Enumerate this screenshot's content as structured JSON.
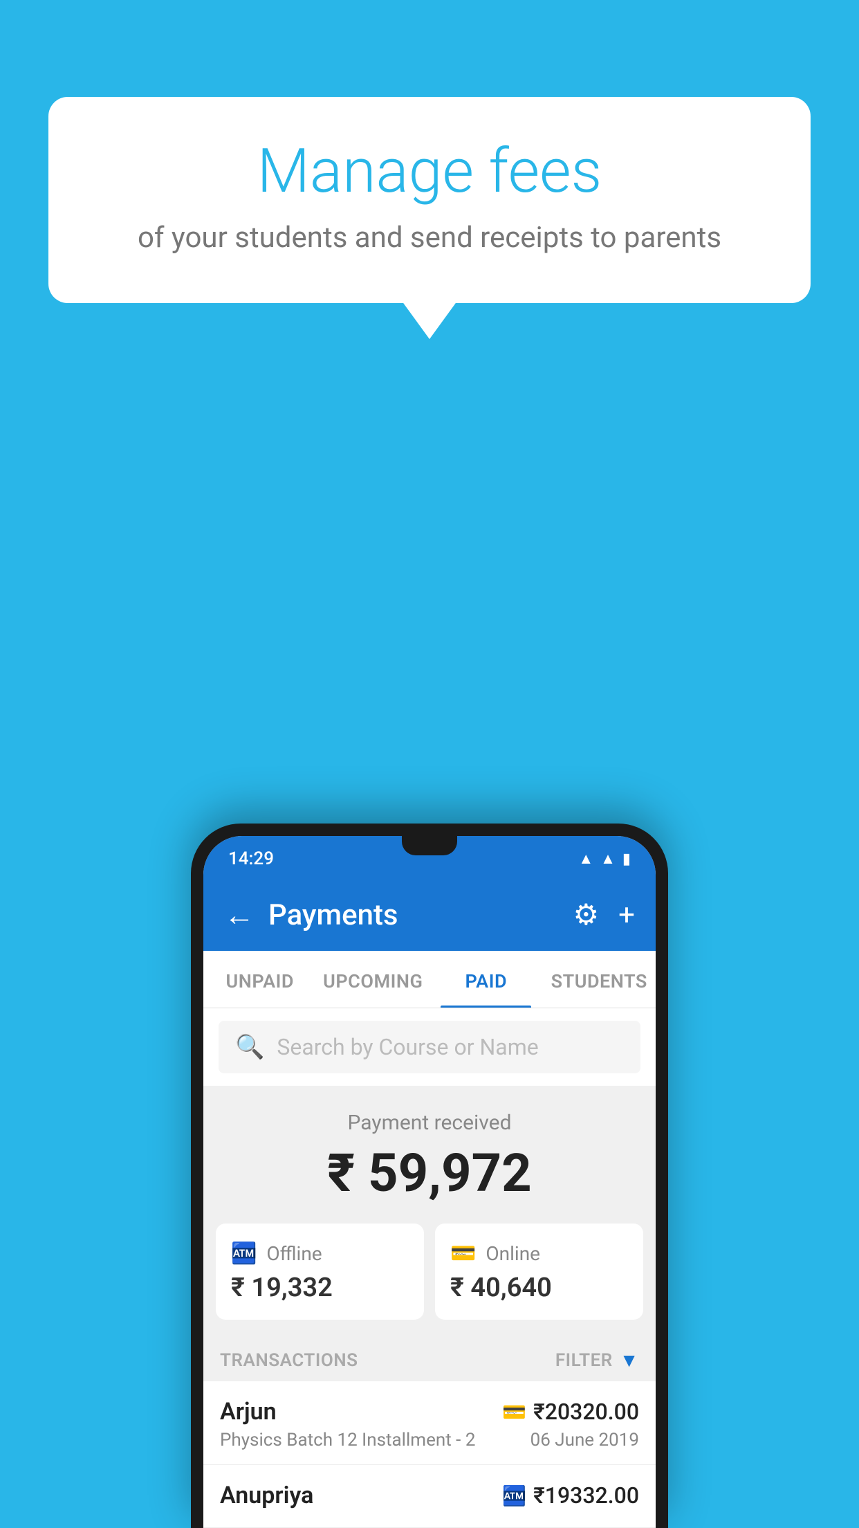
{
  "background_color": "#29B6E8",
  "speech_bubble": {
    "title": "Manage fees",
    "subtitle": "of your students and send receipts to parents"
  },
  "phone": {
    "status_bar": {
      "time": "14:29",
      "wifi": "▲",
      "signal": "▲",
      "battery": "▮"
    },
    "app_bar": {
      "title": "Payments",
      "back_label": "←",
      "settings_icon": "⚙",
      "add_icon": "+"
    },
    "tabs": [
      {
        "label": "UNPAID",
        "active": false
      },
      {
        "label": "UPCOMING",
        "active": false
      },
      {
        "label": "PAID",
        "active": true
      },
      {
        "label": "STUDENTS",
        "active": false
      }
    ],
    "search": {
      "placeholder": "Search by Course or Name"
    },
    "payment_received": {
      "label": "Payment received",
      "amount": "₹ 59,972"
    },
    "payment_cards": [
      {
        "type": "Offline",
        "icon": "💳",
        "amount": "₹ 19,332"
      },
      {
        "type": "Online",
        "icon": "💳",
        "amount": "₹ 40,640"
      }
    ],
    "transactions_header": {
      "label": "TRANSACTIONS",
      "filter_label": "FILTER"
    },
    "transactions": [
      {
        "name": "Arjun",
        "description": "Physics Batch 12 Installment - 2",
        "amount": "₹20320.00",
        "date": "06 June 2019",
        "type": "online"
      },
      {
        "name": "Anupriya",
        "description": "",
        "amount": "₹19332.00",
        "date": "",
        "type": "offline"
      }
    ]
  }
}
